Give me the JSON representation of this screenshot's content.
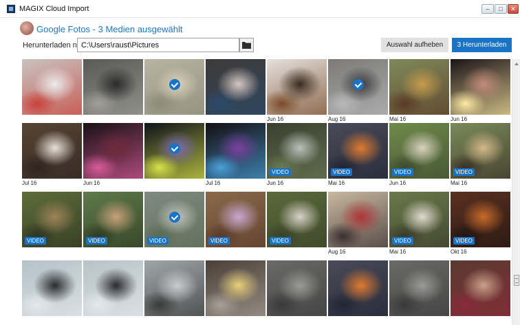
{
  "window": {
    "title": "MAGIX Cloud Import"
  },
  "header": {
    "title": "Google Fotos - 3 Medien ausgewählt",
    "download_label": "Herunterladen nach:",
    "path_value": "C:\\Users\\raust\\Pictures",
    "deselect_label": "Auswahl aufheben",
    "download_button_label": "3 Herunterladen"
  },
  "icons": {
    "app": "app-icon",
    "folder": "folder-icon",
    "selected": "checkmark-icon"
  },
  "colors": {
    "accent": "#1b73c5",
    "title_blue": "#1f75c6",
    "secondary_button": "#e1e1e1"
  },
  "video_badge": "VIDEO",
  "rows": [
    [
      {
        "date": "",
        "video": false,
        "selected": false,
        "bg": "#c9c3c0",
        "fg": "#ececec",
        "accent": "#c8423a"
      },
      {
        "date": "",
        "video": false,
        "selected": false,
        "bg": "#5a5a56",
        "fg": "#2b2b2b",
        "accent": "#a0a098"
      },
      {
        "date": "",
        "video": false,
        "selected": true,
        "bg": "#b8b3a2",
        "fg": "#d9d1b7",
        "accent": "#8c8a78"
      },
      {
        "date": "",
        "video": false,
        "selected": false,
        "bg": "#3e3a38",
        "fg": "#d6c7c1",
        "accent": "#2b4a6b"
      },
      {
        "date": "Jun 16",
        "video": false,
        "selected": false,
        "bg": "#e4e1dd",
        "fg": "#3a2b20",
        "accent": "#7a4b29"
      },
      {
        "date": "Aug 16",
        "video": false,
        "selected": true,
        "bg": "#7c7b79",
        "fg": "#3a3a3c",
        "accent": "#b9b9b9"
      },
      {
        "date": "Mai 16",
        "video": false,
        "selected": false,
        "bg": "#7f8a5a",
        "fg": "#c79b4c",
        "accent": "#5a3a25"
      },
      {
        "date": "Jun 16",
        "video": false,
        "selected": false,
        "bg": "#1b1418",
        "fg": "#c28b7a",
        "accent": "#ffeaa3"
      }
    ],
    [
      {
        "date": "Jul 16",
        "video": false,
        "selected": false,
        "bg": "#574434",
        "fg": "#e8e2d8",
        "accent": "#2e2520"
      },
      {
        "date": "Jun 16",
        "video": false,
        "selected": false,
        "bg": "#1a1114",
        "fg": "#6e2a3b",
        "accent": "#d85c9a"
      },
      {
        "date": "",
        "video": false,
        "selected": true,
        "bg": "#10131a",
        "fg": "#7b6ab0",
        "accent": "#d9e24a"
      },
      {
        "date": "Jul 16",
        "video": false,
        "selected": false,
        "bg": "#140f12",
        "fg": "#7b3fa0",
        "accent": "#4aa0d9"
      },
      {
        "date": "Jun 16",
        "video": true,
        "selected": false,
        "bg": "#3a4030",
        "fg": "#b9c1bb",
        "accent": "#6a7a54"
      },
      {
        "date": "Mai 16",
        "video": true,
        "selected": false,
        "bg": "#4a4a58",
        "fg": "#e07a2e",
        "accent": "#222634"
      },
      {
        "date": "Jun 16",
        "video": true,
        "selected": false,
        "bg": "#6f8a4a",
        "fg": "#d9d2c2",
        "accent": "#3d4a2e"
      },
      {
        "date": "Mai 16",
        "video": true,
        "selected": false,
        "bg": "#7a8a5a",
        "fg": "#d4b98a",
        "accent": "#3a3025"
      }
    ],
    [
      {
        "date": "",
        "video": true,
        "selected": false,
        "bg": "#5d6d3a",
        "fg": "#a08358",
        "accent": "#2f3320"
      },
      {
        "date": "",
        "video": true,
        "selected": false,
        "bg": "#5f7a4a",
        "fg": "#c9a07a",
        "accent": "#2d3a22"
      },
      {
        "date": "",
        "video": true,
        "selected": true,
        "bg": "#7f8a80",
        "fg": "#bfc2bc",
        "accent": "#5a6a52"
      },
      {
        "date": "",
        "video": true,
        "selected": false,
        "bg": "#8a6a4a",
        "fg": "#c9a7d2",
        "accent": "#5a3a28"
      },
      {
        "date": "",
        "video": true,
        "selected": false,
        "bg": "#5a6a3a",
        "fg": "#d8d1c8",
        "accent": "#3a4028"
      },
      {
        "date": "Aug 16",
        "video": false,
        "selected": false,
        "bg": "#c8b8a0",
        "fg": "#b0353a",
        "accent": "#3a3030"
      },
      {
        "date": "Mai 16",
        "video": true,
        "selected": false,
        "bg": "#6a7a4a",
        "fg": "#e0dad0",
        "accent": "#3a3a2a"
      },
      {
        "date": "Okt 16",
        "video": true,
        "selected": false,
        "bg": "#5a3020",
        "fg": "#c96b2a",
        "accent": "#201510"
      }
    ],
    [
      {
        "date": "",
        "video": false,
        "selected": false,
        "bg": "#b5c2c8",
        "fg": "#2a2a30",
        "accent": "#e4e8ea"
      },
      {
        "date": "",
        "video": false,
        "selected": false,
        "bg": "#b8c3c8",
        "fg": "#2a2a30",
        "accent": "#e4e8ea"
      },
      {
        "date": "",
        "video": false,
        "selected": false,
        "bg": "#a0a6a8",
        "fg": "#c8ccce",
        "accent": "#3a3a3a"
      },
      {
        "date": "",
        "video": false,
        "selected": false,
        "bg": "#4a4038",
        "fg": "#e8d07a",
        "accent": "#a8a098"
      },
      {
        "date": "",
        "video": false,
        "selected": false,
        "bg": "#6a6a68",
        "fg": "#9a9a98",
        "accent": "#3a3a3a"
      },
      {
        "date": "",
        "video": false,
        "selected": false,
        "bg": "#4a4a58",
        "fg": "#e07a2e",
        "accent": "#222634"
      },
      {
        "date": "",
        "video": false,
        "selected": false,
        "bg": "#6a6a68",
        "fg": "#9a9a98",
        "accent": "#3a3a3a"
      },
      {
        "date": "",
        "video": false,
        "selected": false,
        "bg": "#5a3a30",
        "fg": "#c9a08a",
        "accent": "#8a2a3a"
      }
    ]
  ]
}
